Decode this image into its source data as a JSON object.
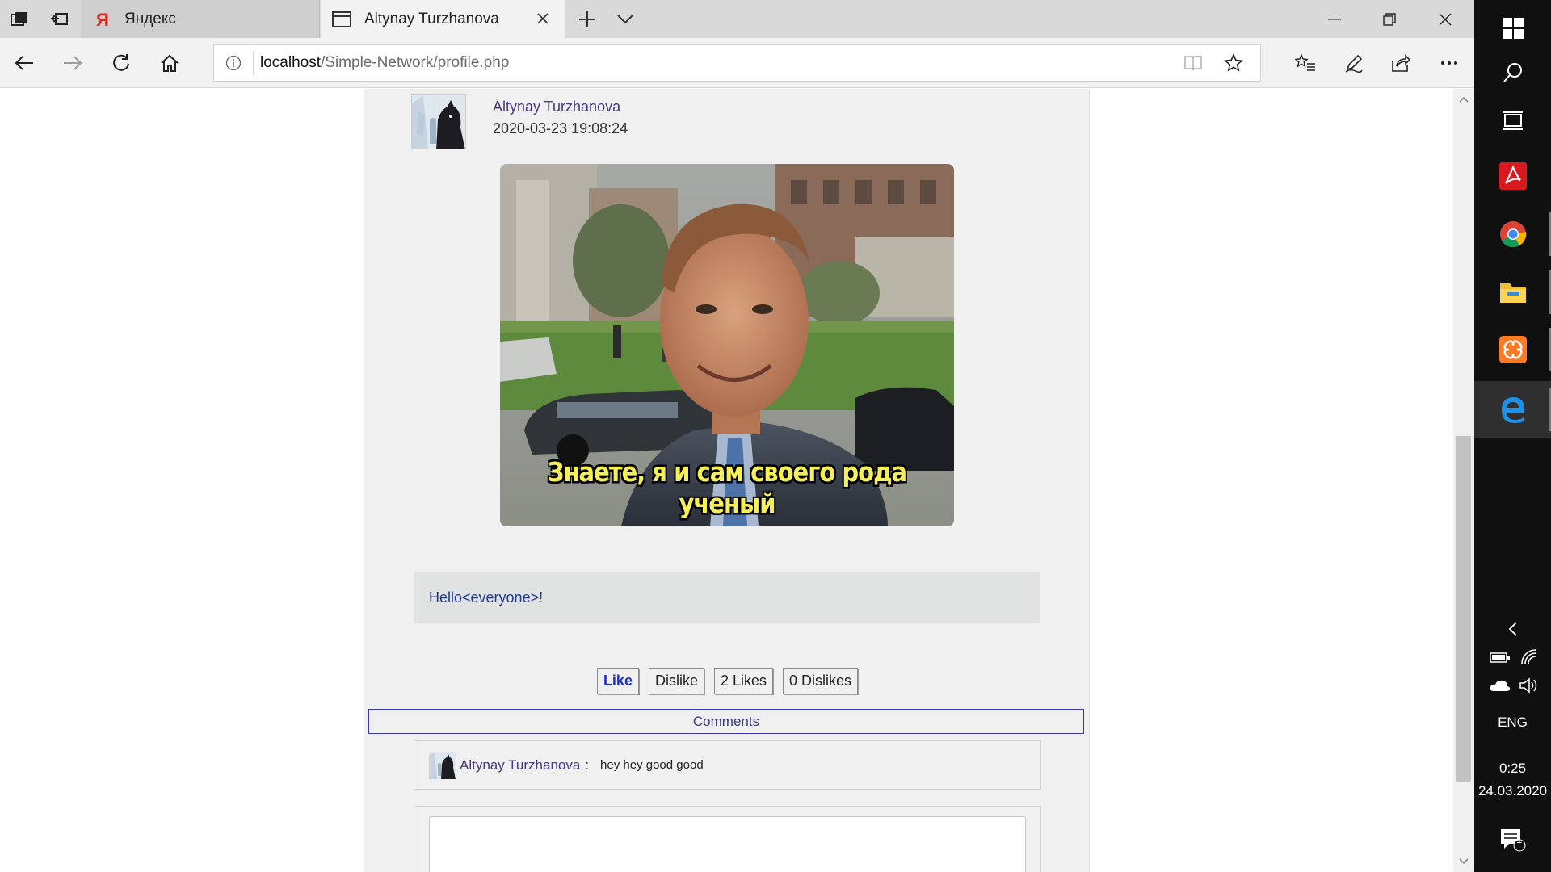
{
  "browser": {
    "tabs": [
      {
        "label": "Яндекс",
        "active": false
      },
      {
        "label": "Altynay Turzhanova",
        "active": true
      }
    ],
    "url": {
      "host": "localhost",
      "path": "/Simple-Network/profile.php"
    }
  },
  "post": {
    "author": "Altynay Turzhanova",
    "date": "2020-03-23 19:08:24",
    "image_caption": "Знаете, я и сам своего рода ученый",
    "text": "Hello<everyone>!"
  },
  "actions": {
    "like": "Like",
    "dislike": "Dislike",
    "likes_count": "2 Likes",
    "dislikes_count": "0 Dislikes"
  },
  "comments": {
    "header": "Comments",
    "items": [
      {
        "author": "Altynay Turzhanova",
        "separator": ":",
        "text": "hey hey good good"
      }
    ]
  },
  "taskbar": {
    "language": "ENG",
    "time": "0:25",
    "date": "24.03.2020",
    "notification_count": "1"
  },
  "colors": {
    "accent_link": "#4a3a7a",
    "like_blue": "#1a2fc4",
    "post_text": "#1f3b8a",
    "content_bg": "#f0f0f0"
  }
}
